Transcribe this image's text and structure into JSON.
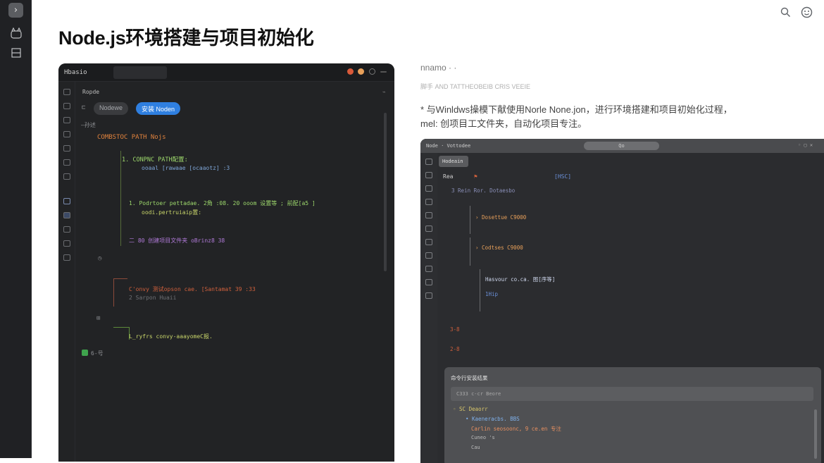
{
  "page": {
    "title": "Node.js环境搭建与项目初始化"
  },
  "rail": {
    "top_icon": "›",
    "icons": [
      "bot-icon",
      "layout-icon"
    ]
  },
  "topbar": {
    "icons": [
      "search-icon",
      "smiley-icon"
    ]
  },
  "left_editor": {
    "app_name": "Hbasio",
    "tab": "",
    "sidebar_title": "Ropde",
    "pill_inactive": "Nodewe",
    "pill_active": "安装 Noden",
    "tree_root": "—孙述",
    "heading": "COMBSTOC PATH Nojs",
    "item1": "1. CONPNC PATH配置:",
    "item1_sub": "ooaal [rawaae  [ocaaotz] :3",
    "item2": "1. Podrtoer pettadae. 2角  :08. 20  ooom  设置等  ; 前配[a5 ]",
    "item2_sub": "oodi.pertruiaip置:",
    "item3": "二 80  创建项目文件夹  oBrinz8 38",
    "cmd1": "C'onvy 测试opson cae. [Santamat 39  :33",
    "cmd1_sub": "2  Sarpon  Huaii",
    "cmd2": "L_ryfrs  convy-aaayomeC报.",
    "footer_badge": "6-号"
  },
  "right_text": {
    "label1": "nnamo · ·",
    "label2": "脚手  AND TATTHEOBEIB  CRIS VEEIE",
    "para_line1": "* 与Winldws操模下献使用Norle None.jon，进行环境搭建和项目初始化过程，",
    "para_line2": "mel: 创项目工文件夹，自动化项目专注。"
  },
  "right_shot": {
    "bar_name": "Node · Vottodee",
    "bar_search": "Qo",
    "tab": "Hodeain",
    "row_name": "Rea",
    "row_tag": "[HSC]",
    "line_a": "3  Rein Ror. Dotaesbo",
    "line_b": "Dosettue C9000",
    "line_c": "Codtses C9000",
    "line_d": "Hasvour co.ca.  图[序等]",
    "line_e": "1Hip",
    "mark1": "3-8",
    "mark2": "2-8",
    "panel_title": "命令行安装结果",
    "panel_input": "C333  c-cr Beore",
    "panel_l1": "◦ SC Deaorr",
    "panel_l2": "• Kaeneracbs. BBS",
    "panel_l3": "Carlin seosoonc,  9 ce.en  专注",
    "panel_l4": "Cuneo 's",
    "panel_l5": "Cau"
  }
}
